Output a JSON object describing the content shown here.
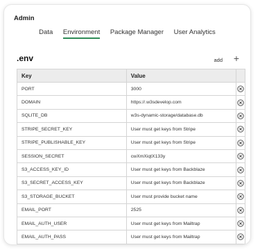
{
  "header": {
    "title": "Admin"
  },
  "tabs": [
    {
      "label": "Data"
    },
    {
      "label": "Environment"
    },
    {
      "label": "Package Manager"
    },
    {
      "label": "User Analytics"
    }
  ],
  "active_tab": "Environment",
  "env": {
    "title": ".env",
    "add_label": "add",
    "columns": {
      "key": "Key",
      "value": "Value"
    },
    "rows": [
      {
        "key": "PORT",
        "value": "3000"
      },
      {
        "key": "DOMAIN",
        "value": "https://.w3sdevelop.com"
      },
      {
        "key": "SQLITE_DB",
        "value": "w3s-dynamic-storage/database.db"
      },
      {
        "key": "STRIPE_SECRET_KEY",
        "value": "User must get keys from Stripe"
      },
      {
        "key": "STRIPE_PUBLISHABLE_KEY",
        "value": "User must get keys from Stripe"
      },
      {
        "key": "SESSION_SECRET",
        "value": "cwXmXiqtX133y"
      },
      {
        "key": "S3_ACCESS_KEY_ID",
        "value": "User must get keys from Backblaze"
      },
      {
        "key": "S3_SECRET_ACCESS_KEY",
        "value": "User must get keys from Backblaze"
      },
      {
        "key": "S3_STORAGE_BUCKET",
        "value": "User must provide bucket name"
      },
      {
        "key": "EMAIL_PORT",
        "value": "2525"
      },
      {
        "key": "EMAIL_AUTH_USER",
        "value": "User must get keys from Mailtrap"
      },
      {
        "key": "EMAIL_AUTH_PASS",
        "value": "User must get keys from Mailtrap"
      }
    ]
  },
  "colors": {
    "accent": "#2e8b57",
    "header_bg": "#ececec",
    "border": "#d4d4d4"
  },
  "icons": {
    "add": "plus-icon",
    "delete": "close-circle-icon"
  }
}
